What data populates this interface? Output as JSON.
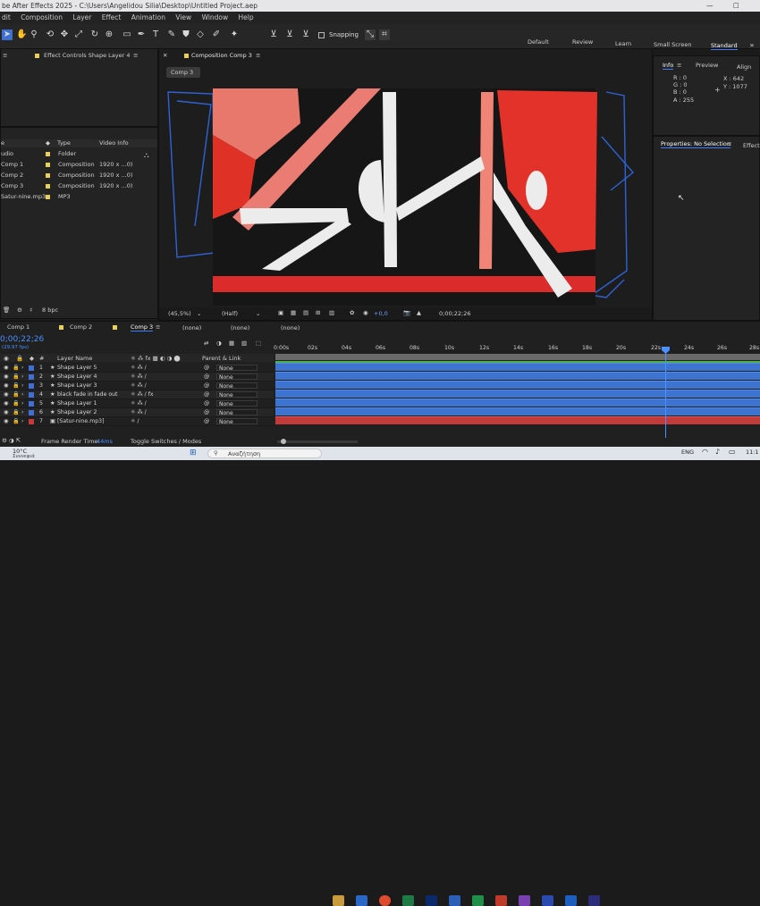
{
  "window": {
    "title": "be After Effects 2025 - C:\\Users\\Angelidou Silia\\Desktop\\Untitled Project.aep",
    "minimize": "—",
    "maximize": "☐"
  },
  "menu": [
    "dit",
    "Composition",
    "Layer",
    "Effect",
    "Animation",
    "View",
    "Window",
    "Help"
  ],
  "toolbar": {
    "snapping_label": "Snapping",
    "workspaces": [
      "Default",
      "Review",
      "Learn",
      "Small Screen",
      "Standard"
    ],
    "active_workspace": "Standard"
  },
  "effect_controls": {
    "tab": "Effect Controls Shape Layer 4"
  },
  "project": {
    "columns": {
      "type": "Type",
      "video_info": "Video Info",
      "name": "e"
    },
    "items": [
      {
        "name": "udio",
        "type": "Folder",
        "info": "",
        "color": "#e4d05a"
      },
      {
        "name": "Comp 1",
        "type": "Composition",
        "info": "1920 x ...0)",
        "color": "#e4d05a"
      },
      {
        "name": "Comp 2",
        "type": "Composition",
        "info": "1920 x ...0)",
        "color": "#e4d05a"
      },
      {
        "name": "Comp 3",
        "type": "Composition",
        "info": "1920 x ...0)",
        "color": "#e4d05a"
      },
      {
        "name": "Satur-nine.mp3",
        "type": "MP3",
        "info": "",
        "color": "#e4d05a"
      }
    ],
    "bpc": "8 bpc"
  },
  "composition": {
    "tab": "Composition Comp 3",
    "sub_tab": "Comp 3",
    "zoom": "(45,5%)",
    "resolution": "(Half)",
    "exposure": "+0,0",
    "timecode": "0;00;22;26"
  },
  "info_panel": {
    "tabs": [
      "Info",
      "Preview",
      "Align"
    ],
    "r": "R : 0",
    "g": "G : 0",
    "b": "B : 0",
    "a": "A : 255",
    "x": "X : 642",
    "y": "Y : 1077"
  },
  "properties": {
    "title": "Properties: No Selection",
    "effects_tab": "Effects"
  },
  "timeline": {
    "tabs": [
      "Comp 1",
      "Comp 2",
      "Comp 3"
    ],
    "active_tab": "Comp 3",
    "none_labels": [
      "(none)",
      "(none)",
      "(none)"
    ],
    "current_time": "0;00;22;26",
    "fps": "(29,97 fps)",
    "columns": {
      "num": "#",
      "layer_name": "Layer Name",
      "parent": "Parent & Link"
    },
    "ruler": [
      "0:00s",
      "02s",
      "04s",
      "06s",
      "08s",
      "10s",
      "12s",
      "14s",
      "16s",
      "18s",
      "20s",
      "22s",
      "24s",
      "26s",
      "28s"
    ],
    "layers": [
      {
        "num": "1",
        "name": "Shape Layer 5",
        "parent": "None",
        "color": "#3f6fd6"
      },
      {
        "num": "2",
        "name": "Shape Layer 4",
        "parent": "None",
        "color": "#3f6fd6"
      },
      {
        "num": "3",
        "name": "Shape Layer 3",
        "parent": "None",
        "color": "#3f6fd6"
      },
      {
        "num": "4",
        "name": "black fade in fade out",
        "parent": "None",
        "color": "#3f6fd6"
      },
      {
        "num": "5",
        "name": "Shape Layer 1",
        "parent": "None",
        "color": "#3f6fd6"
      },
      {
        "num": "6",
        "name": "Shape Layer 2",
        "parent": "None",
        "color": "#3f6fd6"
      },
      {
        "num": "7",
        "name": "[Satur-nine.mp3]",
        "parent": "None",
        "color": "#c9383a"
      }
    ],
    "frame_render_label": "Frame Render Time:",
    "frame_render_value": "44ms",
    "toggle_label": "Toggle Switches / Modes"
  },
  "taskbar": {
    "weather_temp": "10°C",
    "weather_text": "Συννεφιά",
    "search_placeholder": "Αναζήτηση",
    "lang": "ENG",
    "clock": "11:1"
  }
}
